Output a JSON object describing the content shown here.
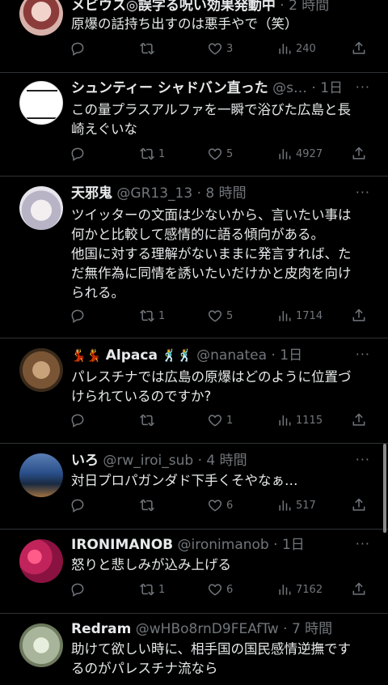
{
  "tweets": [
    {
      "name": "メビウス◎誤字る呪い効果発動中",
      "handle": "",
      "time": "2 時間",
      "text": "原爆の話持ち出すのは悪手やで（笑）",
      "reply": "",
      "retweet": "",
      "like": "3",
      "views": "240",
      "avatar_color": "#c7a7a0"
    },
    {
      "name": "シュンティー シャドバン直った",
      "handle": "@s…",
      "time": "1日",
      "text": "この量プラスアルファを一瞬で浴びた広島と長\n崎えぐいな",
      "reply": "",
      "retweet": "1",
      "like": "5",
      "views": "4927",
      "avatar_color": "#ffffff"
    },
    {
      "name": "天邪鬼",
      "handle": "@GR13_13",
      "time": "8 時間",
      "text": "ツイッターの文面は少ないから、言いたい事は\n何かと比較して感情的に語る傾向がある。\n他国に対する理解がないままに発言すれば、た\nだ無作為に同情を誘いたいだけかと皮肉を向け\nられる。",
      "reply": "",
      "retweet": "1",
      "like": "5",
      "views": "1714",
      "avatar_color": "#d9d6e0"
    },
    {
      "name": "Alpaca",
      "name_prefix": "💃💃",
      "name_suffix": "🕺🕺",
      "handle": "@nanatea",
      "time": "1日",
      "text": "パレスチナでは広島の原爆はどのように位置づ\nけられているのですか?",
      "reply": "",
      "retweet": "",
      "like": "1",
      "views": "1115",
      "avatar_color": "#8a6a4a"
    },
    {
      "name": "いろ",
      "handle": "@rw_iroi_sub",
      "time": "4 時間",
      "text": "対日プロパガンダド下手くそやなぁ…",
      "reply": "",
      "retweet": "",
      "like": "6",
      "views": "517",
      "avatar_color": "#3a5a8a"
    },
    {
      "name": "IRONIMANOB",
      "handle": "@ironimanob",
      "time": "1日",
      "text": "怒りと悲しみが込み上げる",
      "reply": "",
      "retweet": "1",
      "like": "6",
      "views": "7162",
      "avatar_color": "#c0245a"
    },
    {
      "name": "Redram",
      "handle": "@wHBo8rnD9FEAfTw",
      "time": "7 時間",
      "text": "助けて欲しい時に、相手国の国民感情逆撫です\nるのがパレスチナ流なら",
      "reply": "",
      "retweet": "",
      "like": "",
      "views": "",
      "avatar_color": "#a9b59a"
    }
  ],
  "separator": "·",
  "more_icon": "···"
}
